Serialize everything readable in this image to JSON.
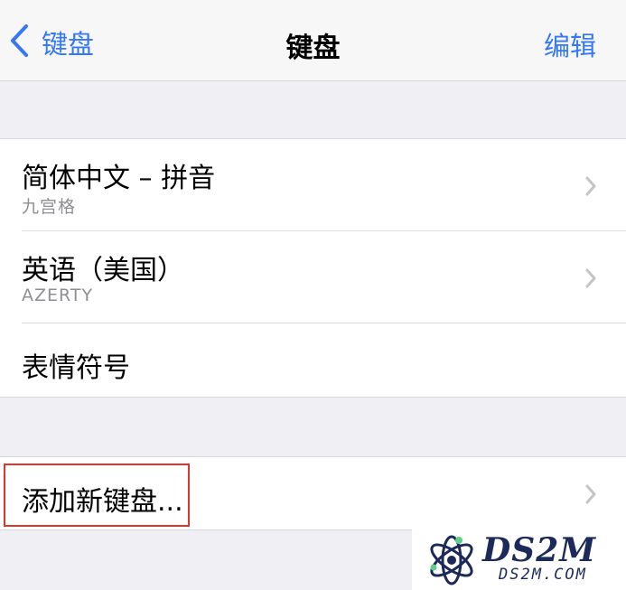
{
  "navbar": {
    "back_label": "键盘",
    "title": "键盘",
    "edit_label": "编辑"
  },
  "keyboards": [
    {
      "title": "简体中文 – 拼音",
      "subtitle": "九宫格"
    },
    {
      "title": "英语（美国）",
      "subtitle": "AZERTY"
    },
    {
      "title": "表情符号"
    }
  ],
  "add_keyboard": {
    "label": "添加新键盘..."
  },
  "watermark": {
    "brand": "DS2M",
    "domain": "DS2M.COM"
  },
  "colors": {
    "accent": "#3478f6",
    "highlight": "#e0352b",
    "background": "#efeff4"
  }
}
